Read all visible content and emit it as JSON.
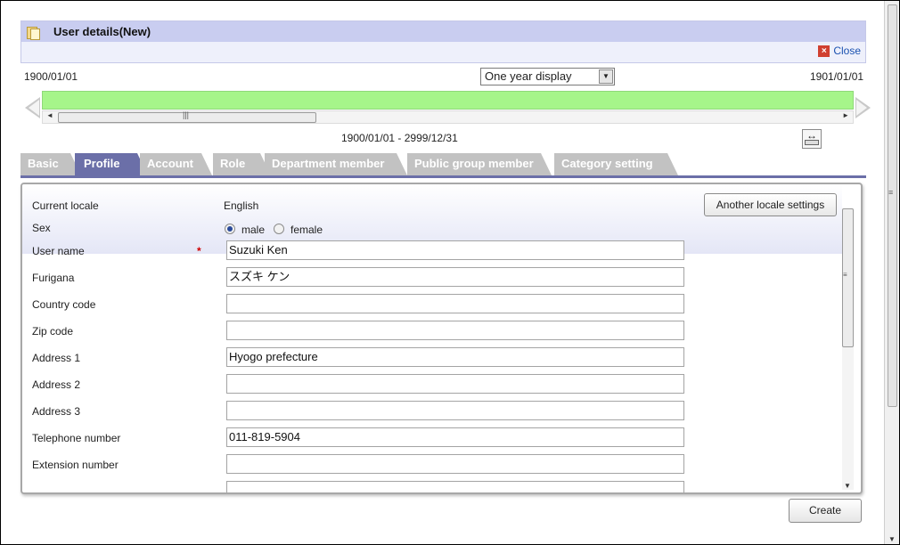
{
  "header": {
    "title": "User details(New)",
    "close_label": "Close"
  },
  "timeline": {
    "start_date": "1900/01/01",
    "end_date": "1901/01/01",
    "display_mode": "One year display",
    "range": "1900/01/01 - 2999/12/31"
  },
  "tabs": [
    {
      "label": "Basic"
    },
    {
      "label": "Profile"
    },
    {
      "label": "Account"
    },
    {
      "label": "Role"
    },
    {
      "label": "Department member"
    },
    {
      "label": "Public group member"
    },
    {
      "label": "Category setting"
    }
  ],
  "active_tab": "Profile",
  "form": {
    "current_locale_label": "Current locale",
    "current_locale_value": "English",
    "another_locale_button": "Another locale settings",
    "sex_label": "Sex",
    "sex_options": [
      "male",
      "female"
    ],
    "sex_selected": "male",
    "required_mark": "*",
    "fields": [
      {
        "label": "User name",
        "value": "Suzuki  Ken"
      },
      {
        "label": "Furigana",
        "value": "スズキ  ケン"
      },
      {
        "label": "Country code",
        "value": ""
      },
      {
        "label": "Zip code",
        "value": ""
      },
      {
        "label": "Address 1",
        "value": "Hyogo prefecture"
      },
      {
        "label": "Address 2",
        "value": ""
      },
      {
        "label": "Address 3",
        "value": ""
      },
      {
        "label": "Telephone number",
        "value": "011-819-5904"
      },
      {
        "label": "Extension number",
        "value": ""
      }
    ]
  },
  "create_button": "Create",
  "colors": {
    "title_bar": "#c9cdf0",
    "active_tab": "#6b6fa8",
    "inactive_tab": "#c2c2c2",
    "timeline_bar": "#a6f58a",
    "required": "#d00000",
    "link": "#1a52b0"
  }
}
